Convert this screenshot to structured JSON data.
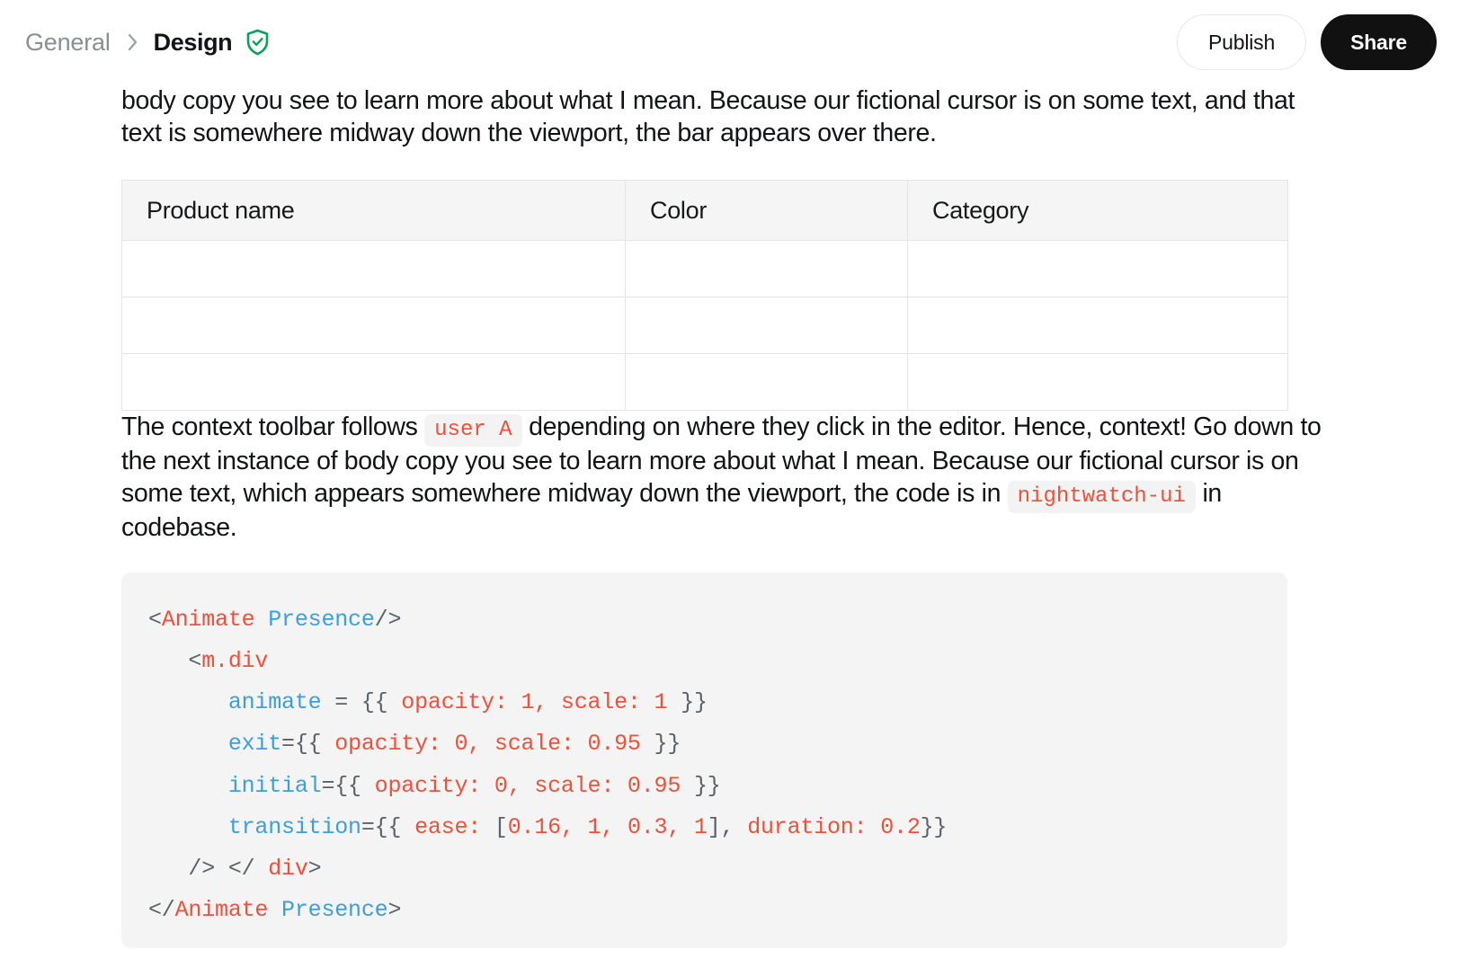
{
  "header": {
    "breadcrumb": {
      "parent": "General",
      "separator_icon": "chevron-right-icon",
      "current": "Design",
      "verified_icon": "shield-check-icon",
      "verified_color": "#0aa05a"
    },
    "actions": {
      "publish_label": "Publish",
      "share_label": "Share"
    }
  },
  "document": {
    "paragraph_1": "body copy you see to learn more about what I mean. Because our fictional cursor is on some text, and that text is somewhere midway down the viewport, the bar appears over there.",
    "table": {
      "columns": [
        "Product name",
        "Color",
        "Category"
      ],
      "rows": [
        [
          "",
          "",
          ""
        ],
        [
          "",
          "",
          ""
        ],
        [
          "",
          "",
          ""
        ]
      ]
    },
    "paragraph_2": {
      "segment_1": "The context toolbar follows ",
      "chip_1": "user A",
      "segment_2": " depending on where they click in the editor. Hence, context! Go down to the next instance of body copy you see to learn more about what I mean. Because our fictional cursor is on some text, which appears somewhere midway down the viewport, the code is in ",
      "chip_2": "nightwatch-ui",
      "segment_3": " in codebase."
    },
    "code_block": {
      "language": "jsx",
      "accent_tag_color": "#f0503a",
      "accent_component_color": "#3c9ede",
      "punct_color": "#5b6166",
      "background": "#f4f4f4",
      "lines": [
        [
          {
            "t": "<",
            "c": "punct"
          },
          {
            "t": "Animate ",
            "c": "tag"
          },
          {
            "t": "Presence",
            "c": "comp"
          },
          {
            "t": "/>",
            "c": "punct"
          }
        ],
        [
          {
            "t": "   <",
            "c": "punct"
          },
          {
            "t": "m.div",
            "c": "tag"
          }
        ],
        [
          {
            "t": "      ",
            "c": "punct"
          },
          {
            "t": "animate",
            "c": "attr"
          },
          {
            "t": " = {{ ",
            "c": "punct"
          },
          {
            "t": "opacity: 1, scale: 1",
            "c": "val"
          },
          {
            "t": " }}",
            "c": "punct"
          }
        ],
        [
          {
            "t": "      ",
            "c": "punct"
          },
          {
            "t": "exit",
            "c": "attr"
          },
          {
            "t": "={{ ",
            "c": "punct"
          },
          {
            "t": "opacity: 0, scale: 0.95",
            "c": "val"
          },
          {
            "t": " }}",
            "c": "punct"
          }
        ],
        [
          {
            "t": "      ",
            "c": "punct"
          },
          {
            "t": "initial",
            "c": "attr"
          },
          {
            "t": "={{ ",
            "c": "punct"
          },
          {
            "t": "opacity: 0, scale: 0.95",
            "c": "val"
          },
          {
            "t": " }}",
            "c": "punct"
          }
        ],
        [
          {
            "t": "      ",
            "c": "punct"
          },
          {
            "t": "transition",
            "c": "attr"
          },
          {
            "t": "={{ ",
            "c": "punct"
          },
          {
            "t": "ease: ",
            "c": "val"
          },
          {
            "t": "[",
            "c": "punct"
          },
          {
            "t": "0.16, 1, 0.3, 1",
            "c": "val"
          },
          {
            "t": "], ",
            "c": "punct"
          },
          {
            "t": "duration: 0.2",
            "c": "val"
          },
          {
            "t": "}}",
            "c": "punct"
          }
        ],
        [
          {
            "t": "   /> </ ",
            "c": "punct"
          },
          {
            "t": "div",
            "c": "tag"
          },
          {
            "t": ">",
            "c": "punct"
          }
        ],
        [
          {
            "t": "</",
            "c": "punct"
          },
          {
            "t": "Animate ",
            "c": "tag"
          },
          {
            "t": "Presence",
            "c": "comp"
          },
          {
            "t": ">",
            "c": "punct"
          }
        ]
      ]
    }
  }
}
